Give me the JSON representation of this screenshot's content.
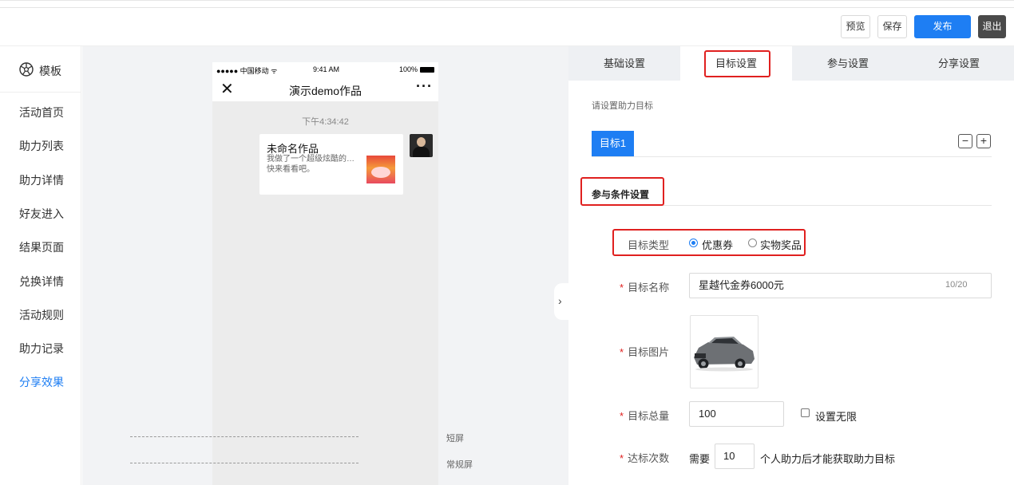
{
  "toolbar": {
    "preview_label": "预览",
    "save_label": "保存",
    "publish_label": "发布",
    "exit_label": "退出"
  },
  "sidebar": {
    "header_label": "模板",
    "items": [
      {
        "label": "活动首页"
      },
      {
        "label": "助力列表"
      },
      {
        "label": "助力详情"
      },
      {
        "label": "好友进入"
      },
      {
        "label": "结果页面"
      },
      {
        "label": "兑换详情"
      },
      {
        "label": "活动规则"
      },
      {
        "label": "助力记录"
      },
      {
        "label": "分享效果",
        "active": true
      }
    ],
    "active_color": "#1e7ef3"
  },
  "phone": {
    "status": {
      "carrier": "●●●●● 中国移动 ᯤ",
      "time": "9:41 AM",
      "battery": "100%"
    },
    "nav_title": "演示demo作品",
    "message_time": "下午4:34:42",
    "card": {
      "title": "未命名作品",
      "desc": "我做了一个超级炫酷的…快来看看吧。"
    },
    "guides": {
      "short_screen": "短屏",
      "normal_screen": "常规屏"
    }
  },
  "panel": {
    "tabs": [
      {
        "label": "基础设置"
      },
      {
        "label": "目标设置",
        "active": true
      },
      {
        "label": "参与设置"
      },
      {
        "label": "分享设置"
      }
    ],
    "hint": "请设置助力目标",
    "goal_tab": "目标1",
    "minus": "−",
    "plus": "+",
    "section_title": "参与条件设置",
    "fields": {
      "type_label": "目标类型",
      "type_options": [
        "优惠券",
        "实物奖品"
      ],
      "type_selected": "优惠券",
      "name_label": "目标名称",
      "name_value": "星越代金券6000元",
      "name_counter": "10/20",
      "image_label": "目标图片",
      "total_label": "目标总量",
      "total_value": "100",
      "unlimited_label": "设置无限",
      "times_label": "达标次数",
      "times_prefix": "需要",
      "times_value": "10",
      "times_suffix": "个人助力后才能获取助力目标"
    },
    "highlight_color": "#e0201f",
    "primary_color": "#1e7ef3"
  }
}
